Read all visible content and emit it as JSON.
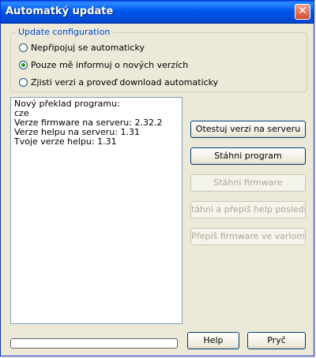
{
  "window": {
    "title": "Automatký update"
  },
  "config": {
    "group_title": "Update configuration",
    "options": [
      {
        "label": "Nepřipojuj se automaticky",
        "checked": false
      },
      {
        "label": "Pouze mě informuj o nových verzích",
        "checked": true
      },
      {
        "label": "Zjisti verzi a proveď download automaticky",
        "checked": false
      }
    ]
  },
  "info_lines": [
    "Nový překlad programu:",
    "cze",
    "Verze firmware na serveru: 2.32.2",
    "Verze helpu na serveru: 1.31",
    "Tvoje verze helpu: 1.31"
  ],
  "buttons": {
    "test_version": "Otestuj verzi na serveru",
    "download_program": "Stáhni program",
    "download_firmware": "Stáhni firmware",
    "download_overwrite_help": "táhni a přepiš help poslední ver.",
    "overwrite_firmware": "Přepiš firmware ve variometru",
    "help": "Help",
    "continue": "Pryč"
  },
  "progress": {
    "value": 0
  },
  "colors": {
    "title_bar": "#0058ee",
    "group_title": "#0046d5"
  }
}
